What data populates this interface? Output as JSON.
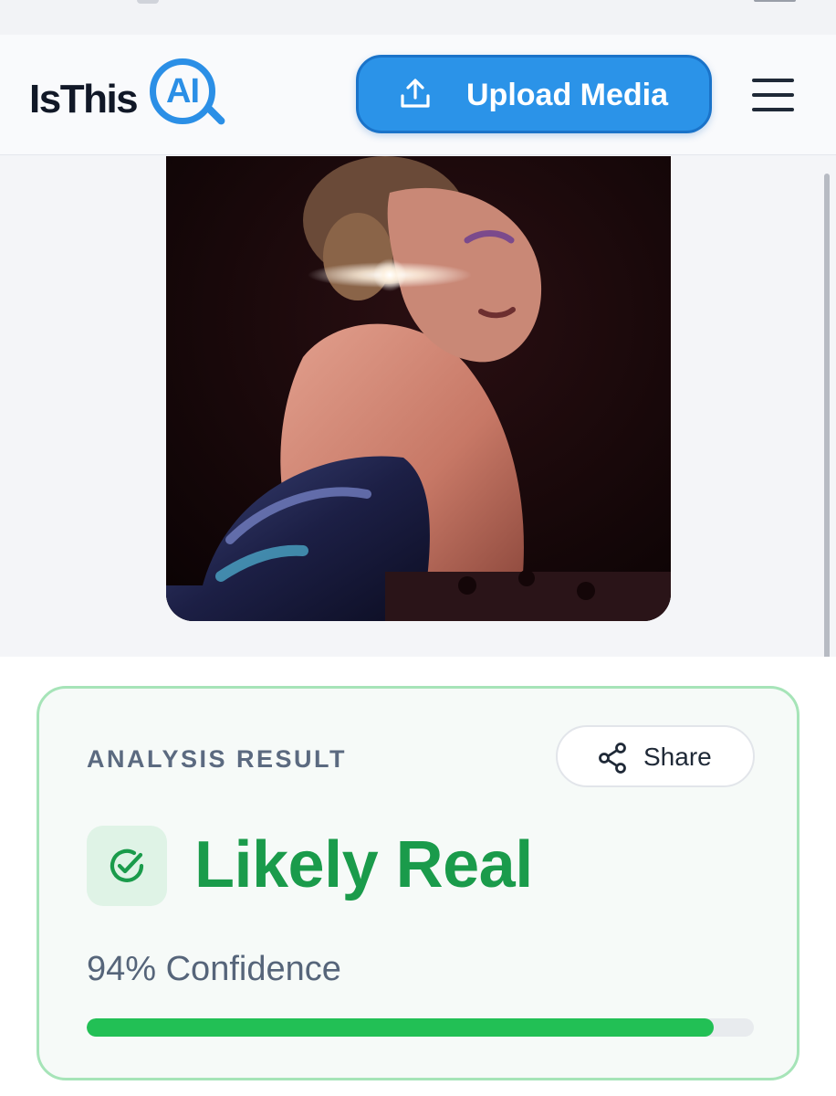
{
  "header": {
    "logo": {
      "text": "IsThis",
      "badge": "AI"
    },
    "upload_button": {
      "label": "Upload Media",
      "icon": "upload-icon"
    },
    "menu_icon": "hamburger-menu-icon"
  },
  "media": {
    "description_icon": "uploaded-photo"
  },
  "result": {
    "heading": "ANALYSIS RESULT",
    "share_label": "Share",
    "verdict": "Likely Real",
    "verdict_icon": "check-circle-icon",
    "confidence_text": "94% Confidence",
    "confidence_value": 0.94
  },
  "colors": {
    "brand_blue": "#2b93e8",
    "verdict_green": "#1a9b4b",
    "progress_green": "#22c055",
    "card_border": "#a6e4b8"
  }
}
